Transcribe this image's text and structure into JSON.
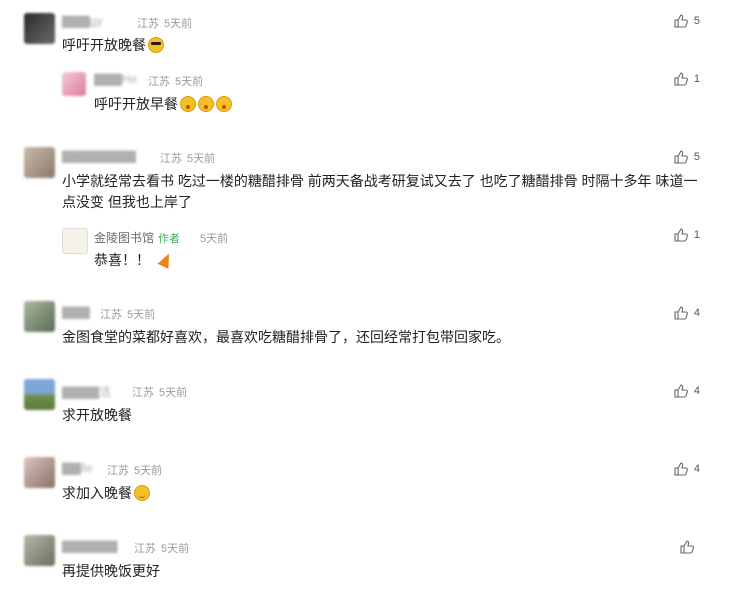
{
  "comments": [
    {
      "location": "江苏",
      "time": "5天前",
      "text": "呼吁开放晚餐",
      "emoji": "sunglasses-emoji",
      "likes": "5",
      "reply": {
        "location": "江苏",
        "time": "5天前",
        "text": "呼吁开放早餐",
        "emoji": "astonished-emoji",
        "likes": "1"
      }
    },
    {
      "location": "江苏",
      "time": "5天前",
      "text": "小学就经常去看书 吃过一楼的糖醋排骨 前两天备战考研复试又去了 也吃了糖醋排骨 时隔十多年 味道一点没变 但我也上岸了",
      "likes": "5",
      "reply": {
        "name": "金陵图书馆",
        "badge": "作者",
        "time": "5天前",
        "text": "恭喜！！",
        "emoji": "party-popper-emoji",
        "likes": "1"
      }
    },
    {
      "location": "江苏",
      "time": "5天前",
      "text": "金图食堂的菜都好喜欢，最喜欢吃糖醋排骨了，还回经常打包带回家吃。",
      "likes": "4"
    },
    {
      "location": "江苏",
      "time": "5天前",
      "text": "求开放晚餐",
      "likes": "4"
    },
    {
      "location": "江苏",
      "time": "5天前",
      "text": "求加入晚餐",
      "emoji": "smile-emoji",
      "likes": "4"
    },
    {
      "location": "江苏",
      "time": "5天前",
      "text": "再提供晚饭更好",
      "likes": ""
    }
  ],
  "colors": {
    "author_badge": "#3fae5c",
    "meta": "#9b9b9b",
    "text": "#222222"
  }
}
